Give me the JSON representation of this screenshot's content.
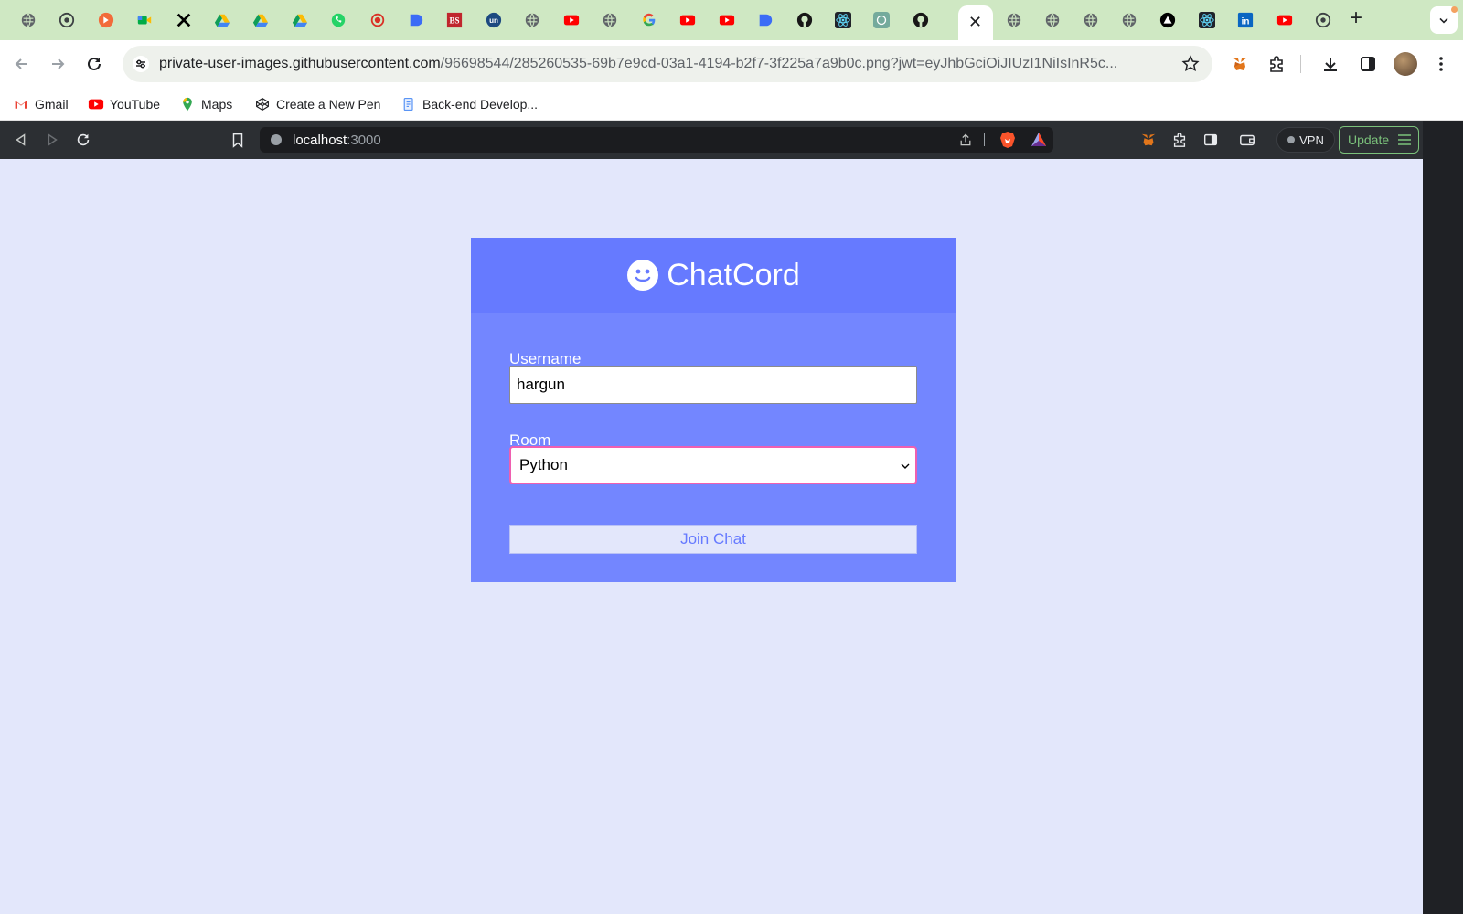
{
  "browser": {
    "address_bar": {
      "url_host": "private-user-images.githubusercontent.com",
      "url_rest": "/96698544/285260535-69b7e9cd-03a1-4194-b2f7-3f225a7a9b0c.png?jwt=eyJhbGciOiJIUzI1NiIsInR5c..."
    },
    "active_tab_close": "✕",
    "new_tab": "+",
    "bookmarks": [
      {
        "label": "Gmail"
      },
      {
        "label": "YouTube"
      },
      {
        "label": "Maps"
      },
      {
        "label": "Create a New Pen"
      },
      {
        "label": "Back-end Develop..."
      }
    ]
  },
  "inner_browser": {
    "host": "localhost",
    "port": ":3000",
    "vpn_label": "VPN",
    "update_label": "Update"
  },
  "app": {
    "brand": "ChatCord",
    "username_label": "Username",
    "username_value": "hargun",
    "room_label": "Room",
    "room_selected": "Python",
    "join_button": "Join Chat"
  },
  "colors": {
    "page_bg": "#e3e7fb",
    "card_bg": "#7386ff",
    "header_bg": "#667aff",
    "select_focus": "#ef5fb0"
  }
}
